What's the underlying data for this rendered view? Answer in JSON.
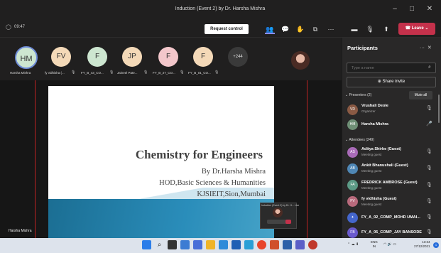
{
  "window": {
    "title": "Induction (Event 2) by Dr. Harsha Mishra"
  },
  "toolbar": {
    "timer": "09:47",
    "request_control": "Request control",
    "leave": "Leave",
    "icons": [
      "people-icon",
      "chat-icon",
      "raise-hand-icon",
      "rooms-icon",
      "more-icon",
      "camera-off-icon",
      "mic-off-icon",
      "share-icon"
    ]
  },
  "strip": {
    "participants": [
      {
        "initials": "HM",
        "name": "Harsha Mishra",
        "color": "#cde6d0"
      },
      {
        "initials": "FV",
        "name": "fy vidhisha (...",
        "color": "#f4d9b8"
      },
      {
        "initials": "F",
        "name": "FY_B_43_CO...",
        "color": "#cde6d0"
      },
      {
        "initials": "JP",
        "name": "Jaineel Pate...",
        "color": "#f4d9b8"
      },
      {
        "initials": "F",
        "name": "FY_B_27_CO...",
        "color": "#f3c7cb"
      },
      {
        "initials": "F",
        "name": "FY_B_01_CO...",
        "color": "#f4d9b8"
      }
    ],
    "more": "+244"
  },
  "slide": {
    "title": "Chemistry for Engineers",
    "lines": [
      "By Dr.Harsha Mishra",
      "HOD,Basic Sciences & Humanities",
      "KJSIEIT,Sion,Mumbai"
    ]
  },
  "pip": {
    "title": "Induction (Event 2) by Dr. H... Live"
  },
  "main_label": "Harsha Mishra",
  "panel": {
    "title": "Participants",
    "search_placeholder": "Type a name",
    "share_invite": "Share invite",
    "presenters_label": "Presenters (2)",
    "mute_all": "Mute all",
    "presenters": [
      {
        "initials": "VD",
        "name": "Vrushali Deole",
        "role": "Organizer",
        "color": "#8a5a44"
      },
      {
        "initials": "HM",
        "name": "Harsha Mishra",
        "role": "",
        "color": "#6f8f76"
      }
    ],
    "attendees_label": "Attendees (249)",
    "attendees": [
      {
        "initials": "AS",
        "name": "Aditya Shirke (Guest)",
        "role": "Meeting guest",
        "color": "#a96bb8"
      },
      {
        "initials": "AB",
        "name": "Ankit Bhanushali (Guest)",
        "role": "Meeting guest",
        "color": "#4f87b5"
      },
      {
        "initials": "FA",
        "name": "FREDRICK AMBROSE (Guest)",
        "role": "Meeting guest",
        "color": "#5c9a86"
      },
      {
        "initials": "FV",
        "name": "fy vidhisha (Guest)",
        "role": "Meeting guest",
        "color": "#b86a7c"
      },
      {
        "initials": "",
        "name": "FY_A_02_COMP_MOHD UMAI...",
        "role": "",
        "color": "#4466cc"
      },
      {
        "initials": "FB",
        "name": "FY_A_05_COMP_JAY BANSODE",
        "role": "",
        "color": "#6a5acd"
      }
    ]
  },
  "taskbar": {
    "lang_top": "ENG",
    "lang_bottom": "IN",
    "time": "13:34",
    "date": "27/12/2021",
    "notif": "1"
  }
}
